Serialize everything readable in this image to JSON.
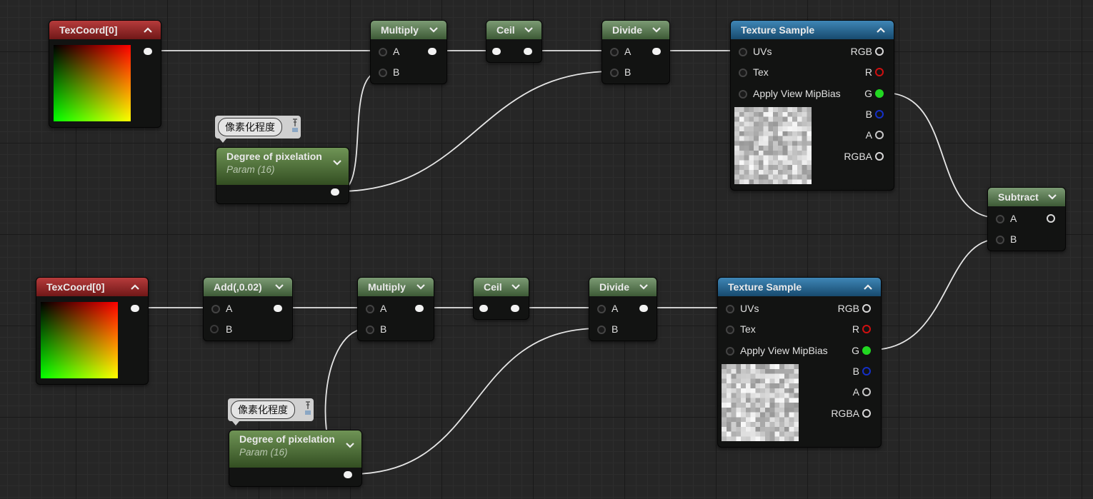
{
  "colors": {
    "texcoord_header": "#8f2a2a",
    "math_header": "#5f7d57",
    "param_header": "#517a3a",
    "texture_header": "#2d6a95",
    "wire": "#e8e8e8",
    "pin_red": "#d01010",
    "pin_green": "#22d822",
    "pin_blue": "#1430c8"
  },
  "graph": {
    "row1": {
      "texcoord": {
        "title": "TexCoord[0]",
        "icon": "chevron-up-icon"
      },
      "multiply": {
        "title": "Multiply",
        "in_a": "A",
        "in_b": "B",
        "icon": "chevron-down-icon"
      },
      "ceil": {
        "title": "Ceil",
        "icon": "chevron-down-icon"
      },
      "divide": {
        "title": "Divide",
        "in_a": "A",
        "in_b": "B",
        "icon": "chevron-down-icon"
      },
      "texture": {
        "title": "Texture Sample",
        "inputs": [
          "UVs",
          "Tex",
          "Apply View MipBias"
        ],
        "outputs": [
          "RGB",
          "R",
          "G",
          "B",
          "A",
          "RGBA"
        ],
        "icon": "chevron-up-icon"
      },
      "comment": "像素化程度",
      "param": {
        "title": "Degree of pixelation",
        "subtitle": "Param (16)"
      }
    },
    "row2": {
      "texcoord": {
        "title": "TexCoord[0]",
        "icon": "chevron-up-icon"
      },
      "add": {
        "title": "Add(,0.02)",
        "in_a": "A",
        "in_b": "B",
        "icon": "chevron-down-icon"
      },
      "multiply": {
        "title": "Multiply",
        "in_a": "A",
        "in_b": "B",
        "icon": "chevron-down-icon"
      },
      "ceil": {
        "title": "Ceil",
        "icon": "chevron-down-icon"
      },
      "divide": {
        "title": "Divide",
        "in_a": "A",
        "in_b": "B",
        "icon": "chevron-down-icon"
      },
      "texture": {
        "title": "Texture Sample",
        "inputs": [
          "UVs",
          "Tex",
          "Apply View MipBias"
        ],
        "outputs": [
          "RGB",
          "R",
          "G",
          "B",
          "A",
          "RGBA"
        ],
        "icon": "chevron-up-icon"
      },
      "comment": "像素化程度",
      "param": {
        "title": "Degree of pixelation",
        "subtitle": "Param (16)"
      }
    },
    "subtract": {
      "title": "Subtract",
      "in_a": "A",
      "in_b": "B",
      "icon": "chevron-down-icon"
    }
  }
}
